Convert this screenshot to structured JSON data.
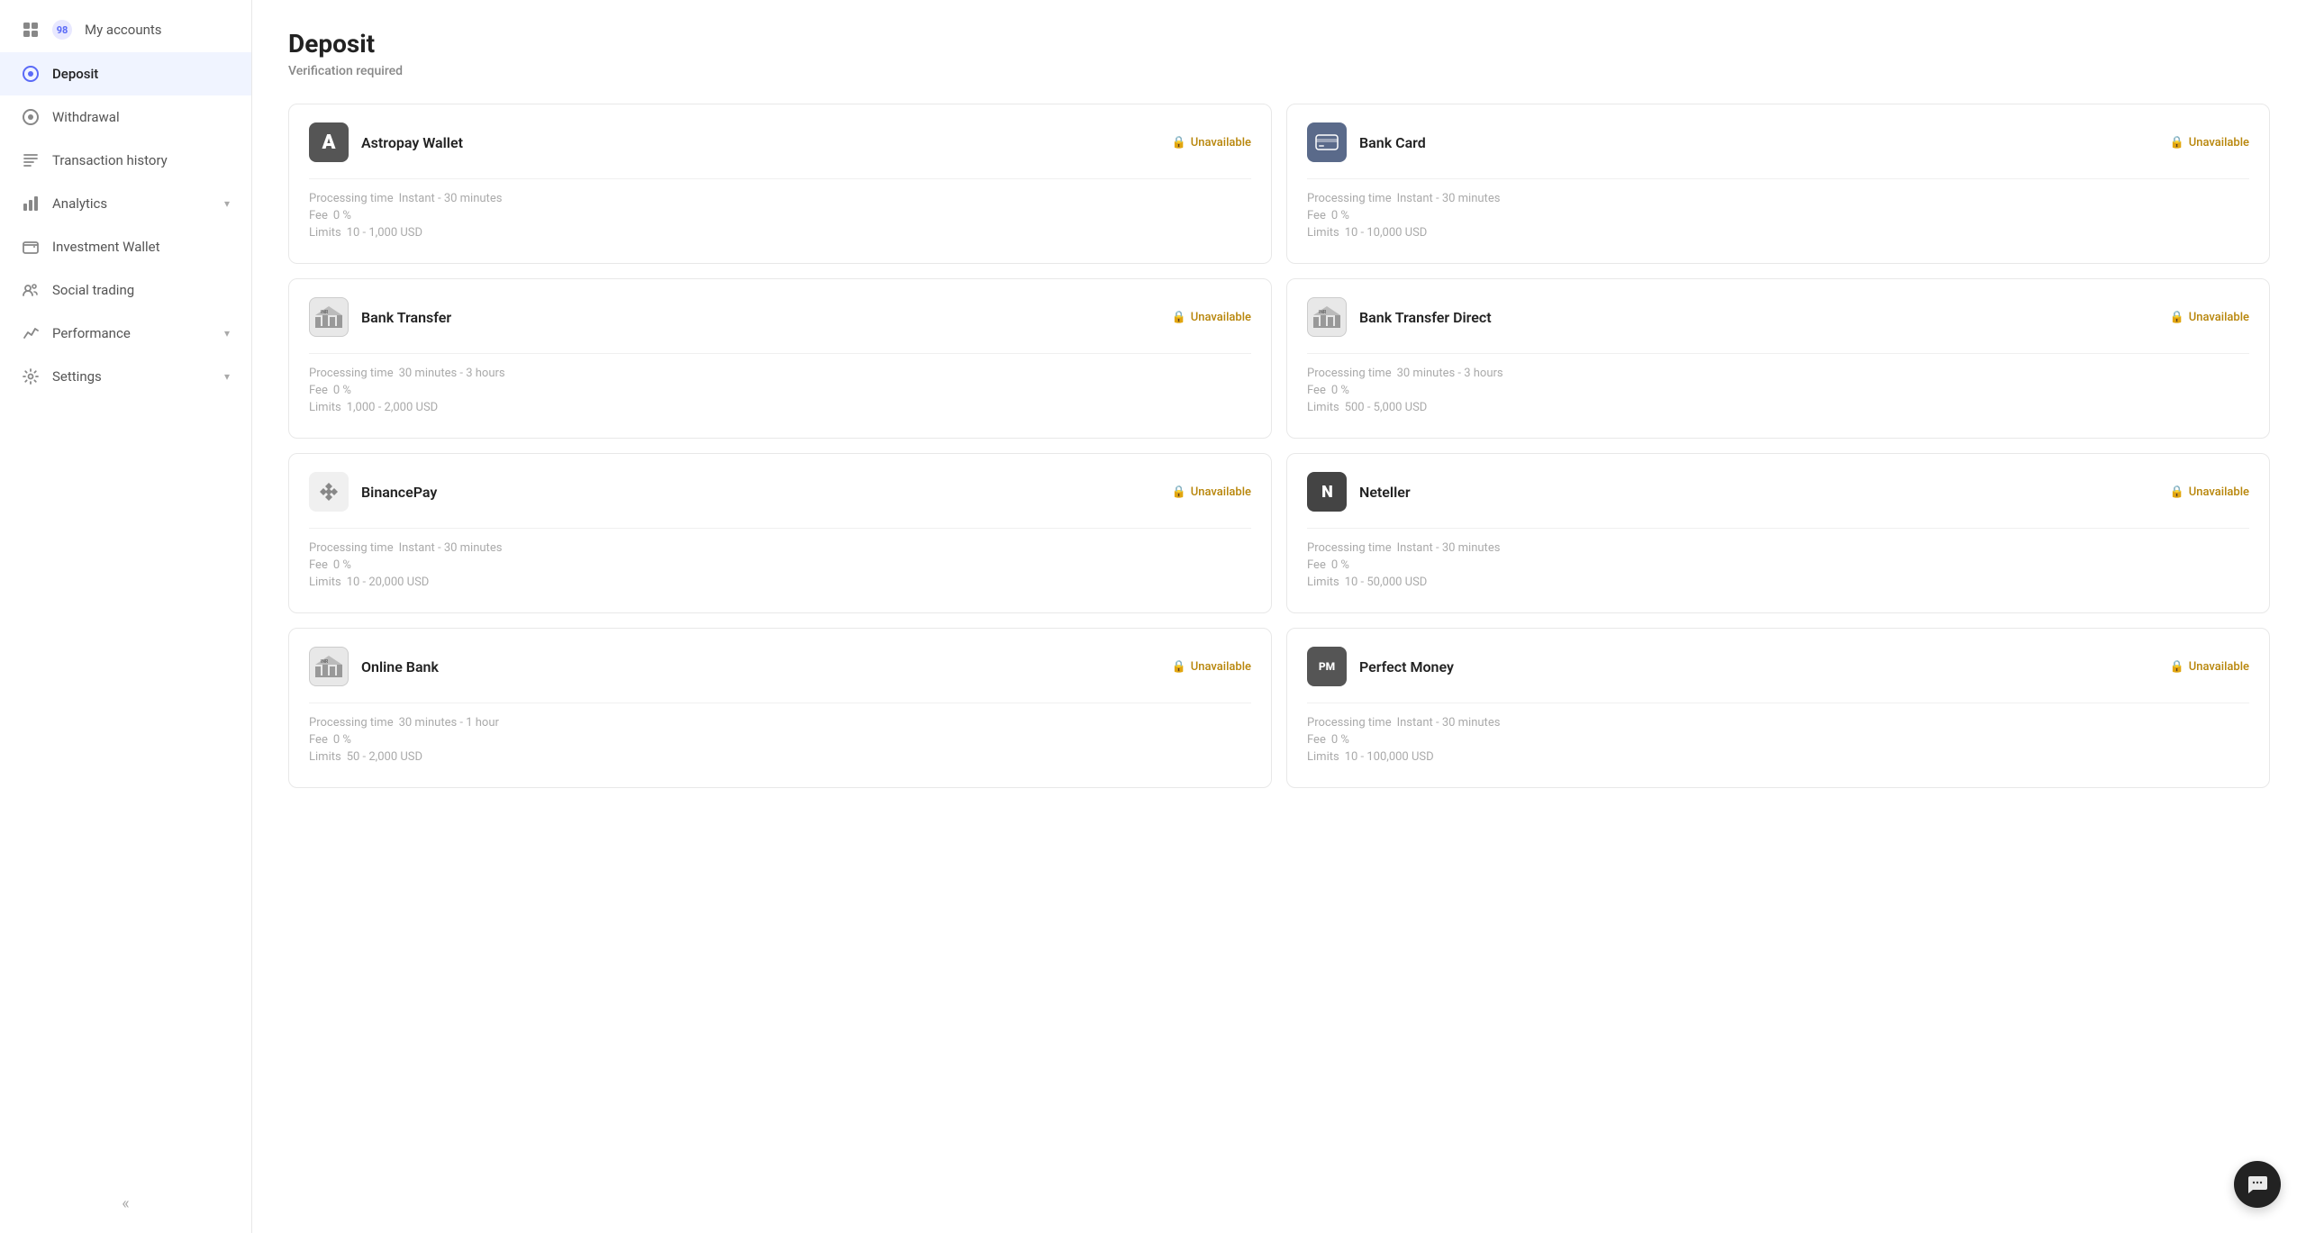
{
  "sidebar": {
    "collapse_label": "«",
    "items": [
      {
        "id": "my-accounts",
        "label": "My accounts",
        "badge": "98",
        "active": false
      },
      {
        "id": "deposit",
        "label": "Deposit",
        "active": true
      },
      {
        "id": "withdrawal",
        "label": "Withdrawal",
        "active": false
      },
      {
        "id": "transaction-history",
        "label": "Transaction history",
        "active": false
      },
      {
        "id": "analytics",
        "label": "Analytics",
        "has_chevron": true,
        "active": false
      },
      {
        "id": "investment-wallet",
        "label": "Investment Wallet",
        "active": false
      },
      {
        "id": "social-trading",
        "label": "Social trading",
        "active": false
      },
      {
        "id": "performance",
        "label": "Performance",
        "has_chevron": true,
        "active": false
      },
      {
        "id": "settings",
        "label": "Settings",
        "has_chevron": true,
        "active": false
      }
    ]
  },
  "page": {
    "title": "Deposit",
    "verification_notice": "Verification required"
  },
  "payment_methods": [
    {
      "id": "astropay",
      "name": "Astropay Wallet",
      "logo_text": "A",
      "logo_style": "dark",
      "status": "Unavailable",
      "processing_time": "Instant - 30 minutes",
      "fee": "0 %",
      "limits": "10 - 1,000 USD"
    },
    {
      "id": "bank-card",
      "name": "Bank Card",
      "logo_text": "card",
      "logo_style": "blue-gray",
      "status": "Unavailable",
      "processing_time": "Instant - 30 minutes",
      "fee": "0 %",
      "limits": "10 - 10,000 USD"
    },
    {
      "id": "bank-transfer",
      "name": "Bank Transfer",
      "logo_text": "INR",
      "logo_style": "default",
      "status": "Unavailable",
      "processing_time": "30 minutes - 3 hours",
      "fee": "0 %",
      "limits": "1,000 - 2,000 USD"
    },
    {
      "id": "bank-transfer-direct",
      "name": "Bank Transfer Direct",
      "logo_text": "INR",
      "logo_style": "default",
      "status": "Unavailable",
      "processing_time": "30 minutes - 3 hours",
      "fee": "0 %",
      "limits": "500 - 5,000 USD"
    },
    {
      "id": "binancepay",
      "name": "BinancePay",
      "logo_text": "◈",
      "logo_style": "default",
      "status": "Unavailable",
      "processing_time": "Instant - 30 minutes",
      "fee": "0 %",
      "limits": "10 - 20,000 USD"
    },
    {
      "id": "neteller",
      "name": "Neteller",
      "logo_text": "N",
      "logo_style": "gray-dark",
      "status": "Unavailable",
      "processing_time": "Instant - 30 minutes",
      "fee": "0 %",
      "limits": "10 - 50,000 USD"
    },
    {
      "id": "online-bank",
      "name": "Online Bank",
      "logo_text": "INR",
      "logo_style": "default",
      "status": "Unavailable",
      "processing_time": "30 minutes - 1 hour",
      "fee": "0 %",
      "limits": "50 - 2,000 USD"
    },
    {
      "id": "perfect-money",
      "name": "Perfect Money",
      "logo_text": "PM",
      "logo_style": "dark",
      "status": "Unavailable",
      "processing_time": "Instant - 30 minutes",
      "fee": "0 %",
      "limits": "10 - 100,000 USD"
    }
  ],
  "labels": {
    "processing_time": "Processing time",
    "fee": "Fee",
    "limits": "Limits"
  }
}
